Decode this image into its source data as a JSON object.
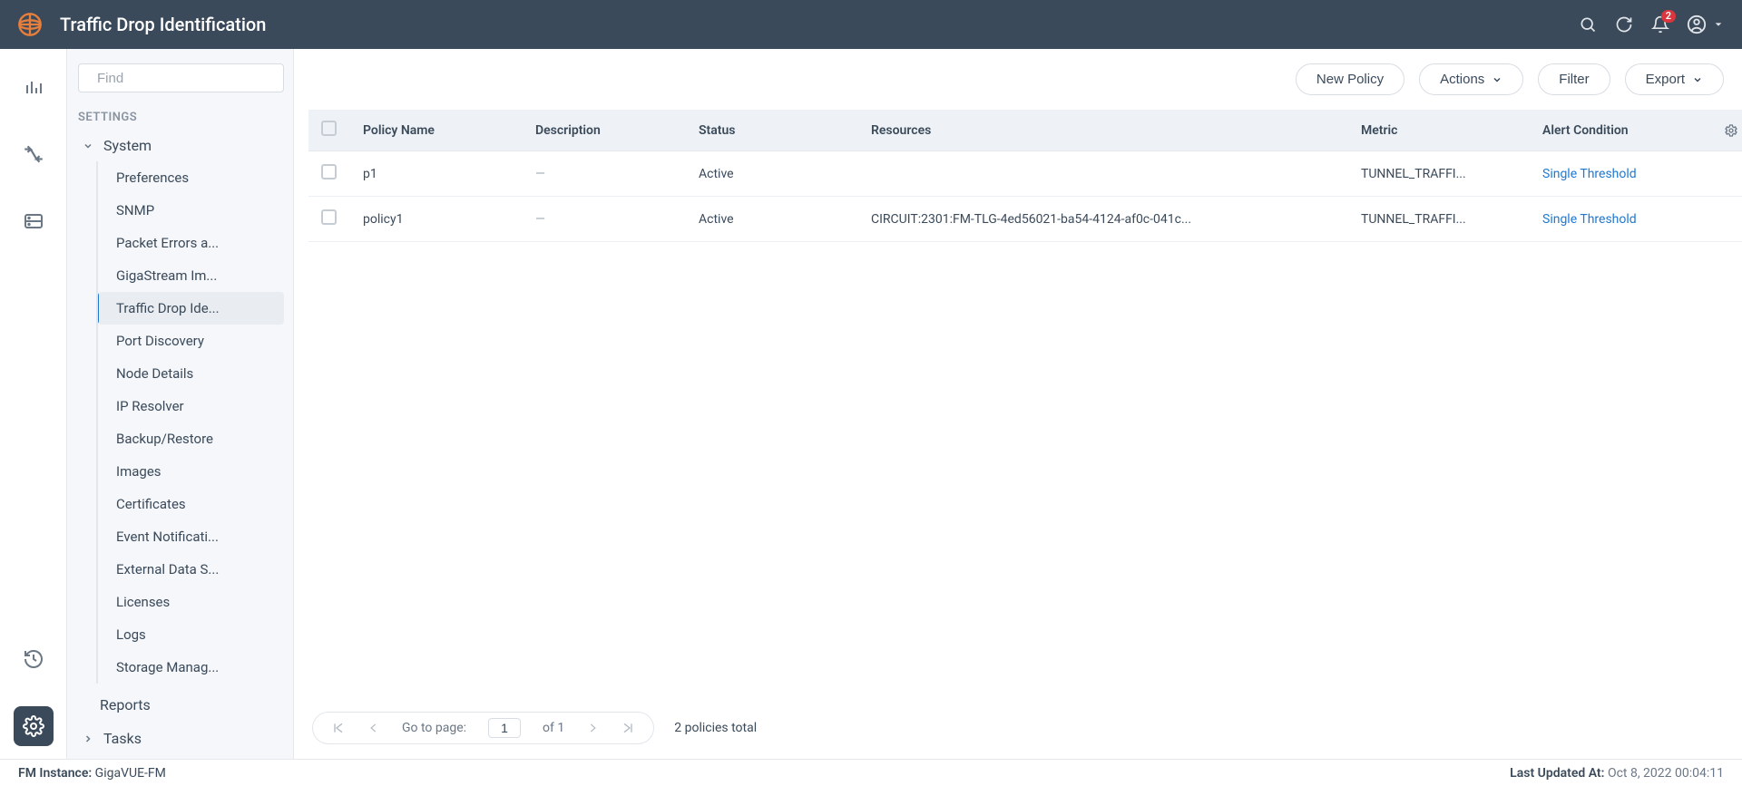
{
  "header": {
    "title": "Traffic Drop Identification",
    "notification_count": "2"
  },
  "sidebar": {
    "search_placeholder": "Find",
    "section": "SETTINGS",
    "group": "System",
    "items": [
      "Preferences",
      "SNMP",
      "Packet Errors a...",
      "GigaStream Im...",
      "Traffic Drop Ide...",
      "Port Discovery",
      "Node Details",
      "IP Resolver",
      "Backup/Restore",
      "Images",
      "Certificates",
      "Event Notificati...",
      "External Data S...",
      "Licenses",
      "Logs",
      "Storage Manag..."
    ],
    "active_index": 4,
    "group2": "Reports",
    "group3": "Tasks"
  },
  "toolbar": {
    "new_policy": "New Policy",
    "actions": "Actions",
    "filter": "Filter",
    "export": "Export"
  },
  "table": {
    "headers": {
      "name": "Policy Name",
      "desc": "Description",
      "status": "Status",
      "resources": "Resources",
      "metric": "Metric",
      "alert": "Alert Condition"
    },
    "rows": [
      {
        "name": "p1",
        "desc": "—",
        "status": "Active",
        "resources": "",
        "metric": "TUNNEL_TRAFFI...",
        "alert": "Single Threshold"
      },
      {
        "name": "policy1",
        "desc": "—",
        "status": "Active",
        "resources": "CIRCUIT:2301:FM-TLG-4ed56021-ba54-4124-af0c-041c...",
        "metric": "TUNNEL_TRAFFI...",
        "alert": "Single Threshold"
      }
    ]
  },
  "pagination": {
    "go_to_page_label": "Go to page:",
    "page": "1",
    "of_label": "of",
    "total_pages": "1",
    "total_text": "2 policies total"
  },
  "statusbar": {
    "instance_label": "FM Instance:",
    "instance_name": "GigaVUE-FM",
    "updated_label": "Last Updated At:",
    "updated_value": "Oct 8, 2022 00:04:11"
  }
}
